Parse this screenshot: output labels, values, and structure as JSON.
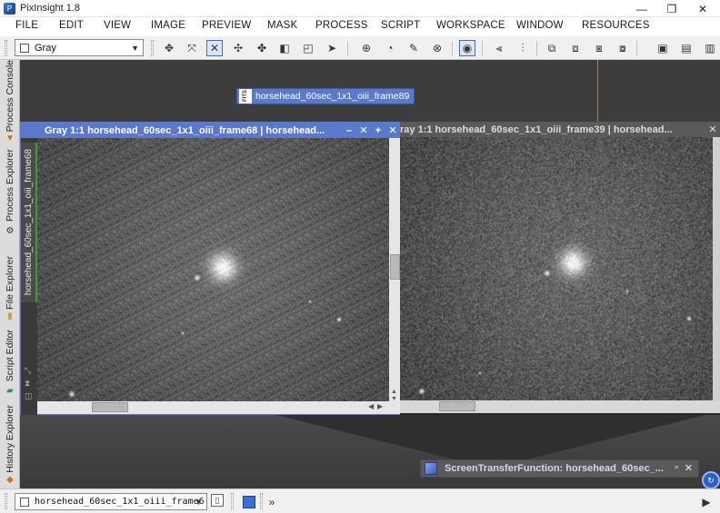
{
  "window": {
    "title": "PixInsight 1.8",
    "minimize_icon": "minimize-icon",
    "maximize_icon": "restore-icon",
    "close_icon": "close-icon"
  },
  "menu": [
    "FILE",
    "EDIT",
    "VIEW",
    "IMAGE",
    "PREVIEW",
    "MASK",
    "PROCESS",
    "SCRIPT",
    "WORKSPACE",
    "WINDOW",
    "RESOURCES"
  ],
  "toolbar": {
    "colorspace_value": "Gray"
  },
  "sidebar": {
    "tabs": [
      "Process Console",
      "Process Explorer",
      "File Explorer",
      "Script Editor",
      "History Explorer"
    ]
  },
  "iconified_image": {
    "badge": "FITS",
    "label": "horsehead_60sec_1x1_oiii_frame89"
  },
  "image_window_1": {
    "title": "Gray 1:1 horsehead_60sec_1x1_oiii_frame68 | horsehead...",
    "side_label": "horsehead_60sec_1x1_oiii_frame68",
    "buttons": [
      "–",
      "✕",
      "+",
      "✕"
    ]
  },
  "image_window_2": {
    "title": "ray 1:1 horsehead_60sec_1x1_oiii_frame39 | horsehead..."
  },
  "stf_window": {
    "title": "ScreenTransferFunction: horsehead_60sec_..."
  },
  "statusbar": {
    "view_selector": "horsehead_60sec_1x1_oiii_frame6",
    "more": "»"
  }
}
